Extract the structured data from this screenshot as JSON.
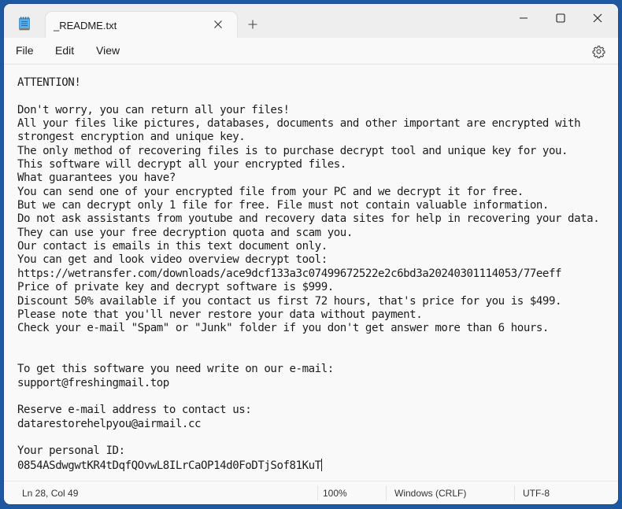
{
  "window": {
    "tab_title": "_README.txt",
    "controls": {
      "minimize": "minimize-icon",
      "maximize": "maximize-icon",
      "close": "close-icon"
    }
  },
  "menu": {
    "items": [
      "File",
      "Edit",
      "View"
    ]
  },
  "editor": {
    "lines": [
      "ATTENTION!",
      "",
      "Don't worry, you can return all your files!",
      "All your files like pictures, databases, documents and other important are encrypted with",
      "strongest encryption and unique key.",
      "The only method of recovering files is to purchase decrypt tool and unique key for you.",
      "This software will decrypt all your encrypted files.",
      "What guarantees you have?",
      "You can send one of your encrypted file from your PC and we decrypt it for free.",
      "But we can decrypt only 1 file for free. File must not contain valuable information.",
      "Do not ask assistants from youtube and recovery data sites for help in recovering your data.",
      "They can use your free decryption quota and scam you.",
      "Our contact is emails in this text document only.",
      "You can get and look video overview decrypt tool:",
      "https://wetransfer.com/downloads/ace9dcf133a3c07499672522e2c6bd3a20240301114053/77eeff",
      "Price of private key and decrypt software is $999.",
      "Discount 50% available if you contact us first 72 hours, that's price for you is $499.",
      "Please note that you'll never restore your data without payment.",
      "Check your e-mail \"Spam\" or \"Junk\" folder if you don't get answer more than 6 hours.",
      "",
      "",
      "To get this software you need write on our e-mail:",
      "support@freshingmail.top",
      "",
      "Reserve e-mail address to contact us:",
      "datarestorehelpyou@airmail.cc",
      "",
      "Your personal ID:",
      "0854ASdwgwtKR4tDqfQOvwL8ILrCaOP14d0FoDTjSof81KuT"
    ]
  },
  "status": {
    "position": "Ln 28, Col 49",
    "zoom": "100%",
    "line_ending": "Windows (CRLF)",
    "encoding": "UTF-8"
  },
  "colors": {
    "desktop": "#1f58a0",
    "window_bg": "#f9f9f9",
    "titlebar_bg": "#eeeeee",
    "notepad_icon": "#4a9fd8"
  }
}
